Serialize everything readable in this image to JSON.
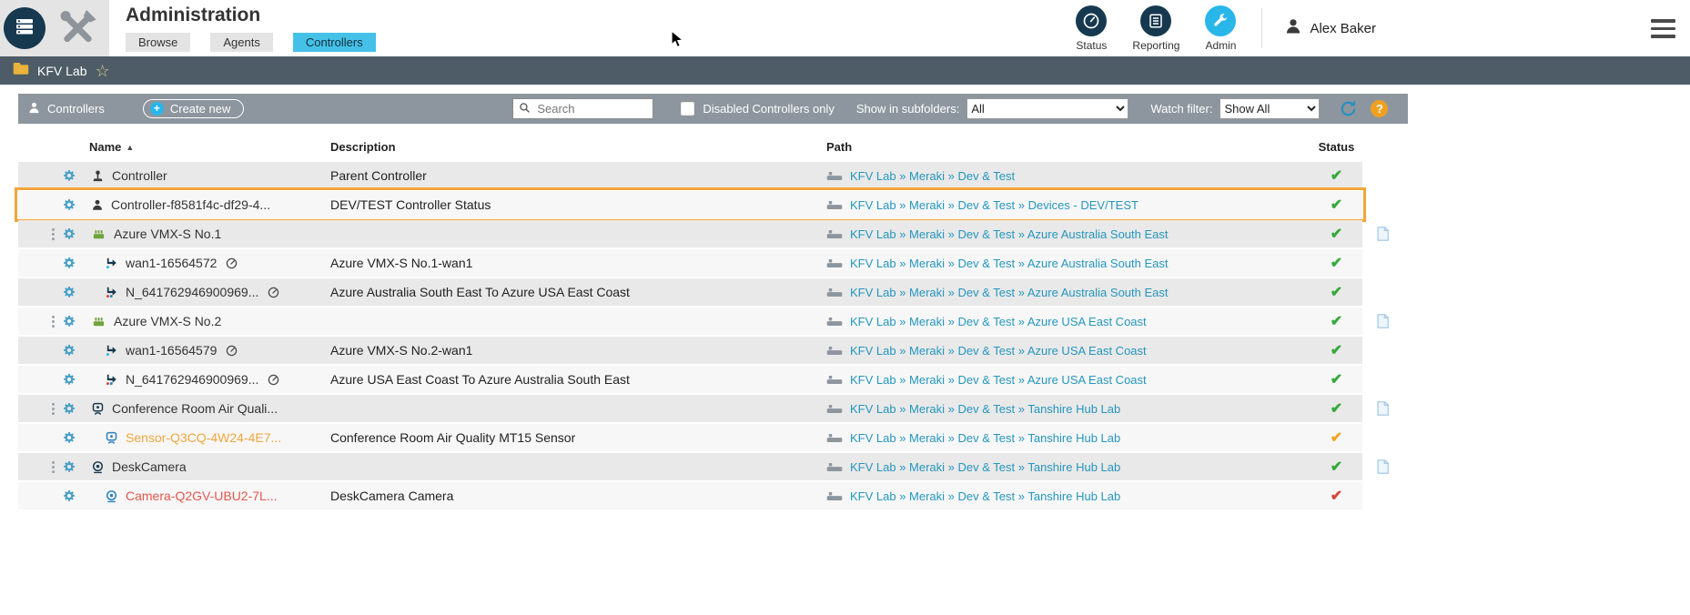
{
  "header": {
    "title": "Administration",
    "tabs": [
      {
        "label": "Browse",
        "active": false
      },
      {
        "label": "Agents",
        "active": false
      },
      {
        "label": "Controllers",
        "active": true
      }
    ],
    "nav": [
      {
        "label": "Status",
        "active": false
      },
      {
        "label": "Reporting",
        "active": false
      },
      {
        "label": "Admin",
        "active": true
      }
    ],
    "user_name": "Alex Baker"
  },
  "breadcrumb": {
    "folder_label": "KFV Lab"
  },
  "toolbar": {
    "section_label": "Controllers",
    "create_plus": "+",
    "create_button": "Create new",
    "search_placeholder": "Search",
    "disabled_filter_label": "Disabled Controllers only",
    "subfolders_label": "Show in subfolders:",
    "subfolders_value": "All",
    "watch_filter_label": "Watch filter:",
    "watch_filter_value": "Show All",
    "help_label": "?"
  },
  "table": {
    "columns": {
      "name": "Name",
      "description": "Description",
      "path": "Path",
      "status": "Status"
    },
    "sort_indicator": "▲",
    "status_glyph": "✔",
    "rows": [
      {
        "icon": "joystick-icon",
        "icon_color": "#3a3a3a",
        "name": "Controller",
        "name_color": "",
        "indent": 0,
        "has_gauge": false,
        "description": "Parent Controller",
        "path": "KFV Lab » Meraki » Dev & Test",
        "status": "ok",
        "has_copy": false,
        "has_handle": false,
        "highlighted": false
      },
      {
        "icon": "agent-icon",
        "icon_color": "#3a3a3a",
        "name": "Controller-f8581f4c-df29-4...",
        "name_color": "",
        "indent": 0,
        "has_gauge": false,
        "description": "DEV/TEST Controller Status",
        "path": "KFV Lab » Meraki » Dev & Test » Devices - DEV/TEST",
        "status": "ok",
        "has_copy": false,
        "has_handle": false,
        "highlighted": true
      },
      {
        "icon": "device-icon",
        "icon_color": "#6fa33c",
        "name": "Azure VMX-S No.1",
        "name_color": "",
        "indent": 0,
        "has_gauge": false,
        "description": "",
        "path": "KFV Lab » Meraki » Dev & Test » Azure Australia South East",
        "status": "ok",
        "has_copy": true,
        "has_handle": true,
        "highlighted": false
      },
      {
        "icon": "interface-icon",
        "icon_color": "#16394f",
        "name": "wan1-16564572",
        "name_color": "",
        "indent": 1,
        "has_gauge": true,
        "description": "Azure VMX-S No.1-wan1",
        "path": "KFV Lab » Meraki » Dev & Test » Azure Australia South East",
        "status": "ok",
        "has_copy": false,
        "has_handle": false,
        "highlighted": false
      },
      {
        "icon": "flow-icon",
        "icon_color": "#16394f",
        "name": "N_641762946900969...",
        "name_color": "",
        "indent": 1,
        "has_gauge": true,
        "description": "Azure Australia South East To Azure USA East Coast",
        "path": "KFV Lab » Meraki » Dev & Test » Azure Australia South East",
        "status": "ok",
        "has_copy": false,
        "has_handle": false,
        "highlighted": false
      },
      {
        "icon": "device-icon",
        "icon_color": "#6fa33c",
        "name": "Azure VMX-S No.2",
        "name_color": "",
        "indent": 0,
        "has_gauge": false,
        "description": "",
        "path": "KFV Lab » Meraki » Dev & Test » Azure USA East Coast",
        "status": "ok",
        "has_copy": true,
        "has_handle": true,
        "highlighted": false
      },
      {
        "icon": "interface-icon",
        "icon_color": "#16394f",
        "name": "wan1-16564579",
        "name_color": "",
        "indent": 1,
        "has_gauge": true,
        "description": "Azure VMX-S No.2-wan1",
        "path": "KFV Lab » Meraki » Dev & Test » Azure USA East Coast",
        "status": "ok",
        "has_copy": false,
        "has_handle": false,
        "highlighted": false
      },
      {
        "icon": "flow-icon",
        "icon_color": "#16394f",
        "name": "N_641762946900969...",
        "name_color": "",
        "indent": 1,
        "has_gauge": true,
        "description": "Azure USA East Coast To Azure Australia South East",
        "path": "KFV Lab » Meraki » Dev & Test » Azure USA East Coast",
        "status": "ok",
        "has_copy": false,
        "has_handle": false,
        "highlighted": false
      },
      {
        "icon": "sensor-icon",
        "icon_color": "#16394f",
        "name": "Conference Room Air Quali...",
        "name_color": "",
        "indent": 0,
        "has_gauge": false,
        "description": "",
        "path": "KFV Lab » Meraki » Dev & Test » Tanshire Hub Lab",
        "status": "ok",
        "has_copy": true,
        "has_handle": true,
        "highlighted": false
      },
      {
        "icon": "sensor-icon",
        "icon_color": "#2a7fc0",
        "name": "Sensor-Q3CQ-4W24-4E7...",
        "name_color": "#f0a63c",
        "indent": 1,
        "has_gauge": false,
        "description": "Conference Room Air Quality MT15 Sensor",
        "path": "KFV Lab » Meraki » Dev & Test » Tanshire Hub Lab",
        "status": "warning",
        "has_copy": false,
        "has_handle": false,
        "highlighted": false
      },
      {
        "icon": "camera-icon",
        "icon_color": "#16394f",
        "name": "DeskCamera",
        "name_color": "",
        "indent": 0,
        "has_gauge": false,
        "description": "",
        "path": "KFV Lab » Meraki » Dev & Test » Tanshire Hub Lab",
        "status": "ok",
        "has_copy": true,
        "has_handle": true,
        "highlighted": false
      },
      {
        "icon": "camera-icon",
        "icon_color": "#2a7fc0",
        "name": "Camera-Q2GV-UBU2-7L...",
        "name_color": "#e2574c",
        "indent": 1,
        "has_gauge": false,
        "description": "DeskCamera Camera",
        "path": "KFV Lab » Meraki » Dev & Test » Tanshire Hub Lab",
        "status": "error",
        "has_copy": false,
        "has_handle": false,
        "highlighted": false
      }
    ]
  },
  "colors": {
    "accent_cyan": "#45c1e8",
    "link_blue": "#2596be",
    "gear_blue": "#4aa0c8",
    "status_ok": "#36a93c",
    "status_warning": "#f2a41f",
    "status_error": "#d5463c",
    "highlight_border": "#f1a53a"
  }
}
